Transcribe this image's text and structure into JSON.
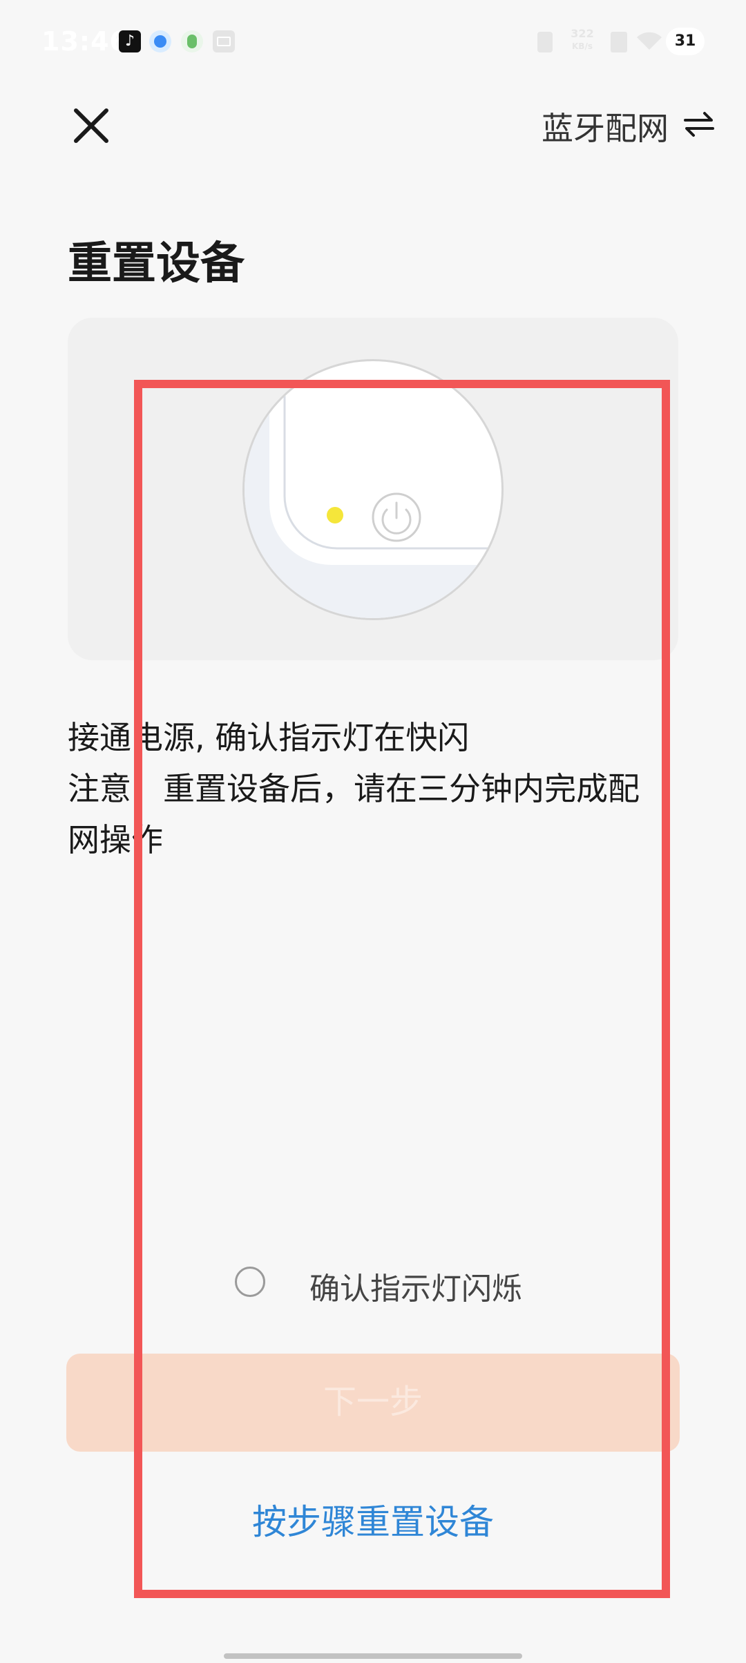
{
  "status_bar": {
    "time": "13:46",
    "net_speed_value": "322",
    "net_speed_unit": "KB/s",
    "battery": "31"
  },
  "header": {
    "bluetooth_pairing_label": "蓝牙配网"
  },
  "page": {
    "title": "重置设备",
    "instruction_line1": "接通电源, 确认指示灯在快闪",
    "instruction_line2": "注意：重置设备后，请在三分钟内完成配",
    "instruction_line3": "网操作"
  },
  "confirm": {
    "label": "确认指示灯闪烁",
    "checked": false
  },
  "next_button": {
    "label": "下一步",
    "enabled": false
  },
  "reset_link": {
    "label": "按步骤重置设备"
  },
  "colors": {
    "accent_link": "#2f86d6",
    "next_button_disabled": "#f8d9c8",
    "indicator_light": "#f5e63a",
    "annotation_box": "#f25656"
  },
  "icons": {
    "close": "close-icon",
    "swap": "swap-arrows-icon",
    "power": "power-icon"
  }
}
